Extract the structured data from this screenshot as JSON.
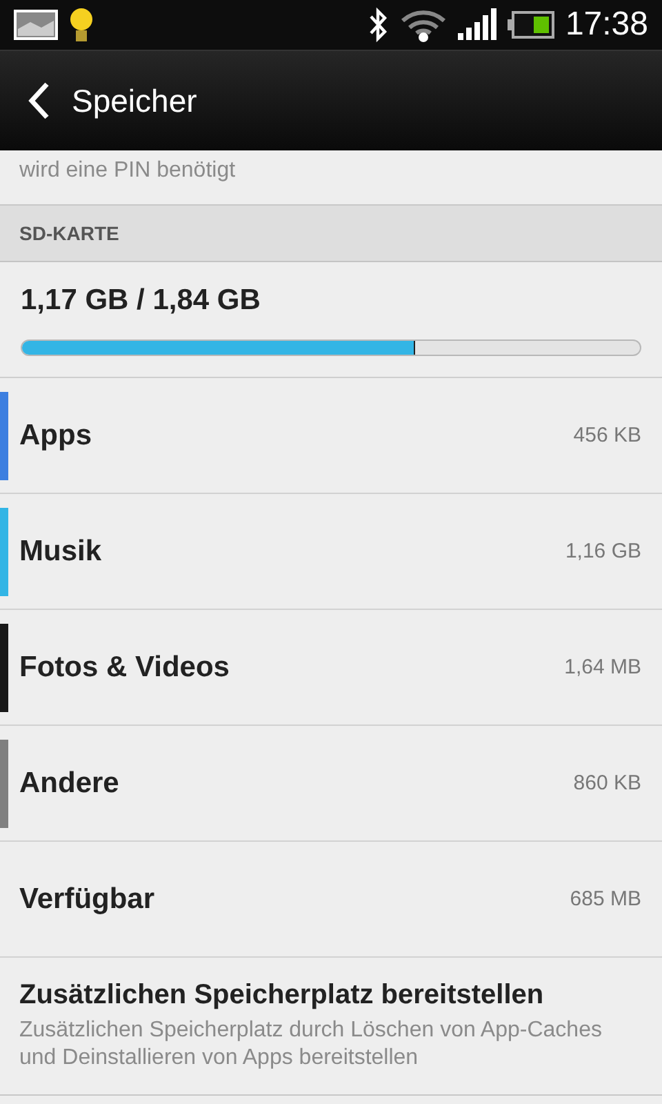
{
  "status_bar": {
    "time": "17:38"
  },
  "action_bar": {
    "title": "Speicher"
  },
  "partial_item": {
    "summary": "wird eine PIN benötigt"
  },
  "section": {
    "header": "SD-KARTE",
    "usage": "1,17 GB / 1,84 GB",
    "level": 0.637
  },
  "categories": [
    {
      "label": "Apps",
      "size": "456 KB",
      "color": "#3d7fe0"
    },
    {
      "label": "Musik",
      "size": "1,16 GB",
      "color": "#33b5e5"
    },
    {
      "label": "Fotos & Videos",
      "size": "1,64 MB",
      "color": "#1a1a1a"
    },
    {
      "label": "Andere",
      "size": "860 KB",
      "color": "#808080"
    },
    {
      "label": "Verfügbar",
      "size": "685 MB"
    }
  ],
  "action_item": {
    "title": "Zusätzlichen Speicherplatz bereitstellen",
    "summary": "Zusätzlichen Speicherplatz durch Löschen von App-Caches und Deinstallieren von Apps bereitstellen"
  }
}
